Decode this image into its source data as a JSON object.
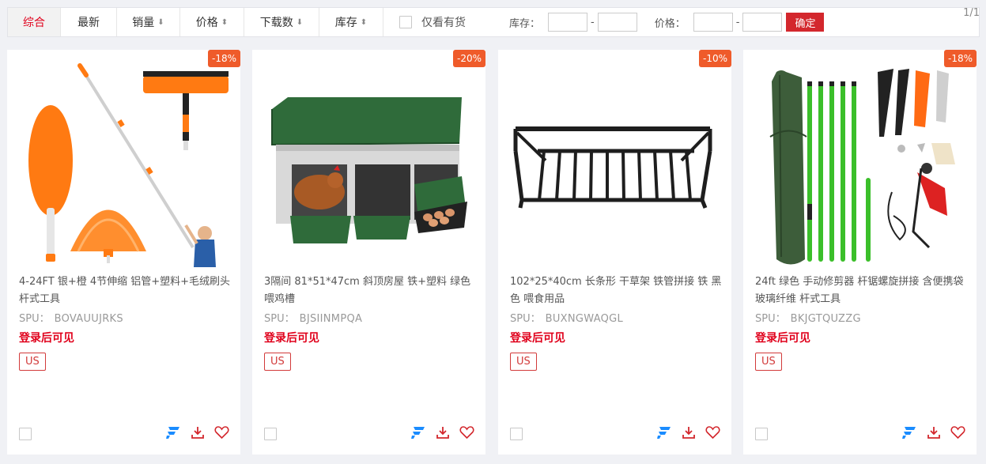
{
  "filters": {
    "tabs": [
      {
        "label": "综合",
        "arrow": ""
      },
      {
        "label": "最新",
        "arrow": ""
      },
      {
        "label": "销量",
        "arrow": "⬇"
      },
      {
        "label": "价格",
        "arrow": "⬍"
      },
      {
        "label": "下载数",
        "arrow": "⬇"
      },
      {
        "label": "库存",
        "arrow": "⬍"
      }
    ],
    "active_tab": "综合",
    "stock_only_label": "仅看有货",
    "stock_label": "库存：",
    "price_label": "价格：",
    "range_dash": "-",
    "confirm_label": "确定",
    "pagination": "1/1"
  },
  "products": [
    {
      "discount": "-18%",
      "title": "4-24FT 银+橙 4节伸缩 铝管+塑料+毛绒刷头 杆式工具",
      "spu_label": "SPU：",
      "spu": "BOVAUUJRKS",
      "login_text": "登录后可见",
      "region": "US",
      "image_icon": "telescopic-duster-image"
    },
    {
      "discount": "-20%",
      "title": "3隔间 81*51*47cm 斜顶房屋 铁+塑料 绿色 喂鸡槽",
      "spu_label": "SPU：",
      "spu": "BJSIINMPQA",
      "login_text": "登录后可见",
      "region": "US",
      "image_icon": "chicken-nesting-box-image"
    },
    {
      "discount": "-10%",
      "title": "102*25*40cm 长条形 干草架 铁管拼接 铁 黑色 喂食用品",
      "spu_label": "SPU：",
      "spu": "BUXNGWAQGL",
      "login_text": "登录后可见",
      "region": "US",
      "image_icon": "hay-rack-image"
    },
    {
      "discount": "-18%",
      "title": "24ft 绿色 手动修剪器 杆锯螺旋拼接 含便携袋 玻璃纤维 杆式工具",
      "spu_label": "SPU：",
      "spu": "BKJGTQUZZG",
      "login_text": "登录后可见",
      "region": "US",
      "image_icon": "pole-saw-kit-image"
    }
  ],
  "colors": {
    "accent_red": "#e0001b",
    "discount_orange": "#ef5b2a",
    "confirm_red": "#d3272d",
    "brand_blue": "#1a8cff"
  }
}
